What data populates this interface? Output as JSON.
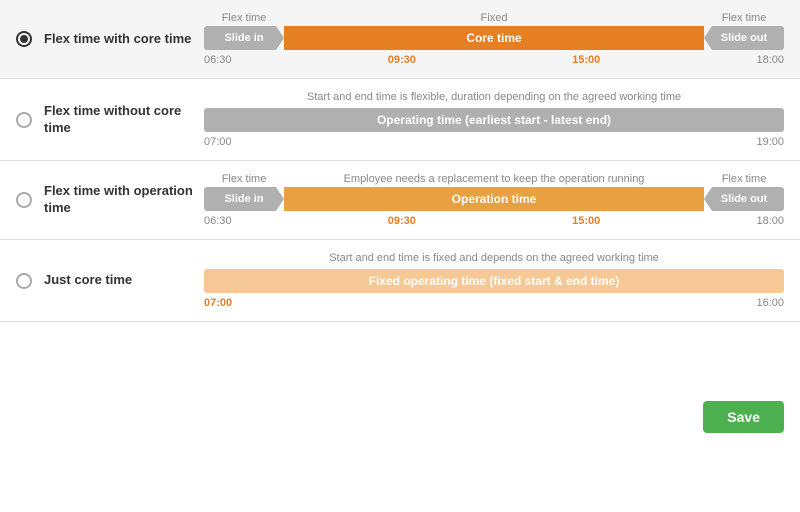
{
  "sections": [
    {
      "id": "flex-core",
      "label": "Flex time with core time",
      "selected": true,
      "diagram": {
        "type": "flex-core",
        "top_labels": [
          "Flex time",
          "Fixed",
          "Flex time"
        ],
        "segments": [
          "Slide in",
          "Core time",
          "Slide out"
        ],
        "times": [
          "06:30",
          "09:30",
          "15:00",
          "18:00"
        ]
      }
    },
    {
      "id": "flex-no-core",
      "label": "Flex time without core time",
      "selected": false,
      "diagram": {
        "type": "operating",
        "description": "Start and end time is flexible, duration depending on the agreed working time",
        "bar_label": "Operating time (earliest start - latest end)",
        "times": [
          "07:00",
          "19:00"
        ]
      }
    },
    {
      "id": "flex-operation",
      "label": "Flex time with operation time",
      "selected": false,
      "diagram": {
        "type": "flex-operation",
        "description": "Employee needs a replacement to keep the operation running",
        "top_labels_left": "Flex time",
        "top_labels_right": "Flex time",
        "segments": [
          "Slide in",
          "Operation time",
          "Slide out"
        ],
        "times": [
          "06:30",
          "09:30",
          "15:00",
          "18:00"
        ]
      }
    },
    {
      "id": "just-core",
      "label": "Just core time",
      "selected": false,
      "diagram": {
        "type": "just-core",
        "description": "Start and end time is fixed and depends on the agreed working time",
        "bar_label": "Fixed operating time (fixed start & end time)",
        "times": [
          "07:00",
          "16:00"
        ]
      }
    }
  ],
  "footer": {
    "save_label": "Save"
  }
}
